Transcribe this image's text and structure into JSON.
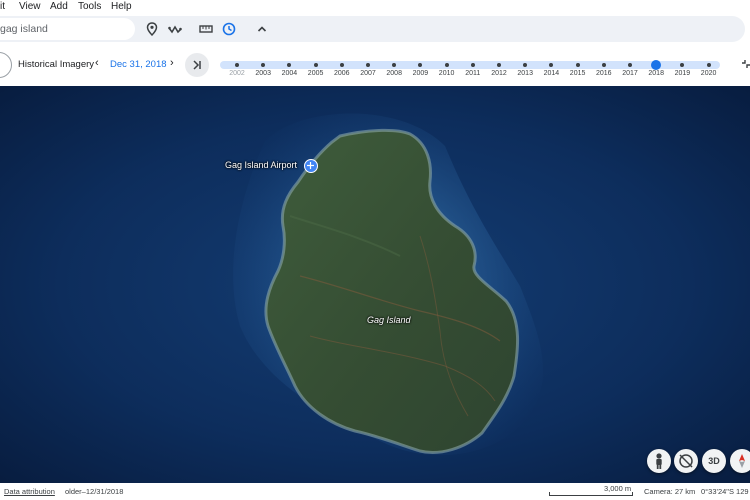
{
  "menu": {
    "items": [
      "it",
      "View",
      "Add",
      "Tools",
      "Help"
    ]
  },
  "search": {
    "value": "gag island"
  },
  "toolbar": {
    "icons": [
      "map-pin-icon",
      "path-icon",
      "ruler-icon",
      "historical-imagery-icon",
      "chevron-up-icon"
    ]
  },
  "history": {
    "label": "Historical Imagery",
    "date": "Dec 31, 2018",
    "prev_icon": "‹",
    "next_icon": "›",
    "years": [
      "2002",
      "2003",
      "2004",
      "2005",
      "2006",
      "2007",
      "2008",
      "2009",
      "2010",
      "2011",
      "2012",
      "2013",
      "2014",
      "2015",
      "2016",
      "2017",
      "2018",
      "2019",
      "2020"
    ],
    "selected_year": "2018"
  },
  "map": {
    "airport_label": "Gag Island Airport",
    "island_label": "Gag Island",
    "buttons": {
      "three_d": "3D"
    }
  },
  "status": {
    "data_attribution": "Data attribution",
    "imagery_date": "older–12/31/2018",
    "scale": "3,000 m",
    "camera": "Camera: 27 km",
    "coords": "0°33'24\"S 129"
  },
  "colors": {
    "accent": "#1a73e8",
    "ocean": "#0c2a55",
    "island": "#3c5a3a"
  }
}
